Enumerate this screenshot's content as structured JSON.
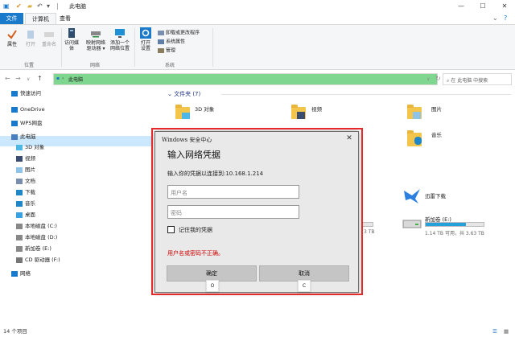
{
  "window": {
    "title": "此电脑",
    "min": "—",
    "max": "☐",
    "close": "✕"
  },
  "tabs": {
    "file": "文件",
    "computer": "计算机",
    "view": "查看"
  },
  "ribbon": {
    "properties": "属性",
    "open": "打开",
    "rename": "重命名",
    "group_location": "位置",
    "access_media": "访问媒体",
    "map_drive_l1": "映射网络",
    "map_drive_l2": "驱动器 ▾",
    "add_location_l1": "添加一个",
    "add_location_l2": "网络位置",
    "group_network": "网络",
    "open_settings_l1": "打开",
    "open_settings_l2": "设置",
    "uninstall": "卸载或更改程序",
    "system_properties": "系统属性",
    "manage": "管理",
    "group_system": "系统"
  },
  "address": {
    "path": "此电脑",
    "search_placeholder": "在 此电脑 中搜索"
  },
  "sidebar": {
    "items": [
      "快速访问",
      "OneDrive",
      "WPS网盘",
      "此电脑",
      "3D 对象",
      "视频",
      "图片",
      "文档",
      "下载",
      "音乐",
      "桌面",
      "本地磁盘 (C:)",
      "本地磁盘 (D:)",
      "新加卷 (E:)",
      "CD 驱动器 (F:)",
      "网络"
    ]
  },
  "content": {
    "section_folders": "文件夹 (7)",
    "folders": [
      "3D 对象",
      "视频",
      "图片",
      "音乐"
    ],
    "app_xunlei": "迅雷下载",
    "drive_e_name": "新加卷 (E:)",
    "drive_e_info": "1.14 TB 可用，共 3.63 TB",
    "drive_e_used_fraction": 0.69,
    "partial_drive_info": "3 TB"
  },
  "status": {
    "count": "14 个项目"
  },
  "dialog": {
    "title": "Windows 安全中心",
    "heading": "输入网络凭据",
    "prompt": "输入你的凭据以连接到:10.168.1.214",
    "username_placeholder": "用户名",
    "password_placeholder": "密码",
    "remember": "记住我的凭据",
    "error": "用户名或密码不正确。",
    "ok": "确定",
    "cancel": "取消",
    "ok_key": "O",
    "cancel_key": "C",
    "close": "✕"
  },
  "colors": {
    "accent": "#1979ca",
    "address_highlight": "#7fd68e",
    "error": "#d00000",
    "highlight_frame": "#e52a2a"
  }
}
